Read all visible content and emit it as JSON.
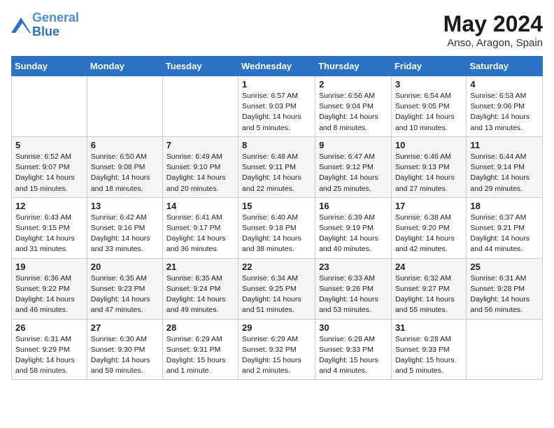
{
  "header": {
    "logo_line1": "General",
    "logo_line2": "Blue",
    "month": "May 2024",
    "location": "Anso, Aragon, Spain"
  },
  "days_of_week": [
    "Sunday",
    "Monday",
    "Tuesday",
    "Wednesday",
    "Thursday",
    "Friday",
    "Saturday"
  ],
  "weeks": [
    [
      {
        "day": "",
        "sunrise": "",
        "sunset": "",
        "daylight": ""
      },
      {
        "day": "",
        "sunrise": "",
        "sunset": "",
        "daylight": ""
      },
      {
        "day": "",
        "sunrise": "",
        "sunset": "",
        "daylight": ""
      },
      {
        "day": "1",
        "sunrise": "Sunrise: 6:57 AM",
        "sunset": "Sunset: 9:03 PM",
        "daylight": "Daylight: 14 hours and 5 minutes."
      },
      {
        "day": "2",
        "sunrise": "Sunrise: 6:56 AM",
        "sunset": "Sunset: 9:04 PM",
        "daylight": "Daylight: 14 hours and 8 minutes."
      },
      {
        "day": "3",
        "sunrise": "Sunrise: 6:54 AM",
        "sunset": "Sunset: 9:05 PM",
        "daylight": "Daylight: 14 hours and 10 minutes."
      },
      {
        "day": "4",
        "sunrise": "Sunrise: 6:53 AM",
        "sunset": "Sunset: 9:06 PM",
        "daylight": "Daylight: 14 hours and 13 minutes."
      }
    ],
    [
      {
        "day": "5",
        "sunrise": "Sunrise: 6:52 AM",
        "sunset": "Sunset: 9:07 PM",
        "daylight": "Daylight: 14 hours and 15 minutes."
      },
      {
        "day": "6",
        "sunrise": "Sunrise: 6:50 AM",
        "sunset": "Sunset: 9:08 PM",
        "daylight": "Daylight: 14 hours and 18 minutes."
      },
      {
        "day": "7",
        "sunrise": "Sunrise: 6:49 AM",
        "sunset": "Sunset: 9:10 PM",
        "daylight": "Daylight: 14 hours and 20 minutes."
      },
      {
        "day": "8",
        "sunrise": "Sunrise: 6:48 AM",
        "sunset": "Sunset: 9:11 PM",
        "daylight": "Daylight: 14 hours and 22 minutes."
      },
      {
        "day": "9",
        "sunrise": "Sunrise: 6:47 AM",
        "sunset": "Sunset: 9:12 PM",
        "daylight": "Daylight: 14 hours and 25 minutes."
      },
      {
        "day": "10",
        "sunrise": "Sunrise: 6:46 AM",
        "sunset": "Sunset: 9:13 PM",
        "daylight": "Daylight: 14 hours and 27 minutes."
      },
      {
        "day": "11",
        "sunrise": "Sunrise: 6:44 AM",
        "sunset": "Sunset: 9:14 PM",
        "daylight": "Daylight: 14 hours and 29 minutes."
      }
    ],
    [
      {
        "day": "12",
        "sunrise": "Sunrise: 6:43 AM",
        "sunset": "Sunset: 9:15 PM",
        "daylight": "Daylight: 14 hours and 31 minutes."
      },
      {
        "day": "13",
        "sunrise": "Sunrise: 6:42 AM",
        "sunset": "Sunset: 9:16 PM",
        "daylight": "Daylight: 14 hours and 33 minutes."
      },
      {
        "day": "14",
        "sunrise": "Sunrise: 6:41 AM",
        "sunset": "Sunset: 9:17 PM",
        "daylight": "Daylight: 14 hours and 36 minutes."
      },
      {
        "day": "15",
        "sunrise": "Sunrise: 6:40 AM",
        "sunset": "Sunset: 9:18 PM",
        "daylight": "Daylight: 14 hours and 38 minutes."
      },
      {
        "day": "16",
        "sunrise": "Sunrise: 6:39 AM",
        "sunset": "Sunset: 9:19 PM",
        "daylight": "Daylight: 14 hours and 40 minutes."
      },
      {
        "day": "17",
        "sunrise": "Sunrise: 6:38 AM",
        "sunset": "Sunset: 9:20 PM",
        "daylight": "Daylight: 14 hours and 42 minutes."
      },
      {
        "day": "18",
        "sunrise": "Sunrise: 6:37 AM",
        "sunset": "Sunset: 9:21 PM",
        "daylight": "Daylight: 14 hours and 44 minutes."
      }
    ],
    [
      {
        "day": "19",
        "sunrise": "Sunrise: 6:36 AM",
        "sunset": "Sunset: 9:22 PM",
        "daylight": "Daylight: 14 hours and 46 minutes."
      },
      {
        "day": "20",
        "sunrise": "Sunrise: 6:35 AM",
        "sunset": "Sunset: 9:23 PM",
        "daylight": "Daylight: 14 hours and 47 minutes."
      },
      {
        "day": "21",
        "sunrise": "Sunrise: 6:35 AM",
        "sunset": "Sunset: 9:24 PM",
        "daylight": "Daylight: 14 hours and 49 minutes."
      },
      {
        "day": "22",
        "sunrise": "Sunrise: 6:34 AM",
        "sunset": "Sunset: 9:25 PM",
        "daylight": "Daylight: 14 hours and 51 minutes."
      },
      {
        "day": "23",
        "sunrise": "Sunrise: 6:33 AM",
        "sunset": "Sunset: 9:26 PM",
        "daylight": "Daylight: 14 hours and 53 minutes."
      },
      {
        "day": "24",
        "sunrise": "Sunrise: 6:32 AM",
        "sunset": "Sunset: 9:27 PM",
        "daylight": "Daylight: 14 hours and 55 minutes."
      },
      {
        "day": "25",
        "sunrise": "Sunrise: 6:31 AM",
        "sunset": "Sunset: 9:28 PM",
        "daylight": "Daylight: 14 hours and 56 minutes."
      }
    ],
    [
      {
        "day": "26",
        "sunrise": "Sunrise: 6:31 AM",
        "sunset": "Sunset: 9:29 PM",
        "daylight": "Daylight: 14 hours and 58 minutes."
      },
      {
        "day": "27",
        "sunrise": "Sunrise: 6:30 AM",
        "sunset": "Sunset: 9:30 PM",
        "daylight": "Daylight: 14 hours and 59 minutes."
      },
      {
        "day": "28",
        "sunrise": "Sunrise: 6:29 AM",
        "sunset": "Sunset: 9:31 PM",
        "daylight": "Daylight: 15 hours and 1 minute."
      },
      {
        "day": "29",
        "sunrise": "Sunrise: 6:29 AM",
        "sunset": "Sunset: 9:32 PM",
        "daylight": "Daylight: 15 hours and 2 minutes."
      },
      {
        "day": "30",
        "sunrise": "Sunrise: 6:28 AM",
        "sunset": "Sunset: 9:33 PM",
        "daylight": "Daylight: 15 hours and 4 minutes."
      },
      {
        "day": "31",
        "sunrise": "Sunrise: 6:28 AM",
        "sunset": "Sunset: 9:33 PM",
        "daylight": "Daylight: 15 hours and 5 minutes."
      },
      {
        "day": "",
        "sunrise": "",
        "sunset": "",
        "daylight": ""
      }
    ]
  ]
}
